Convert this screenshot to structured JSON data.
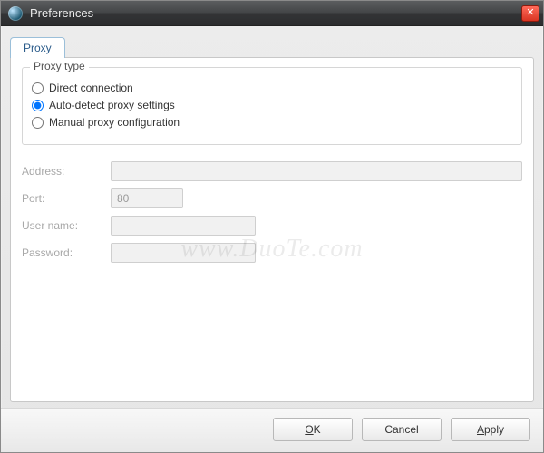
{
  "window": {
    "title": "Preferences"
  },
  "tabs": {
    "proxy": "Proxy"
  },
  "proxy_type": {
    "legend": "Proxy type",
    "options": {
      "direct": "Direct connection",
      "auto": "Auto-detect proxy settings",
      "manual": "Manual proxy configuration"
    },
    "selected": "auto"
  },
  "form": {
    "address_label": "Address:",
    "address_value": "",
    "port_label": "Port:",
    "port_value": "80",
    "username_label": "User name:",
    "username_value": "",
    "password_label": "Password:",
    "password_value": ""
  },
  "buttons": {
    "ok": "OK",
    "cancel": "Cancel",
    "apply": "Apply"
  },
  "watermark": "www.DuoTe.com"
}
